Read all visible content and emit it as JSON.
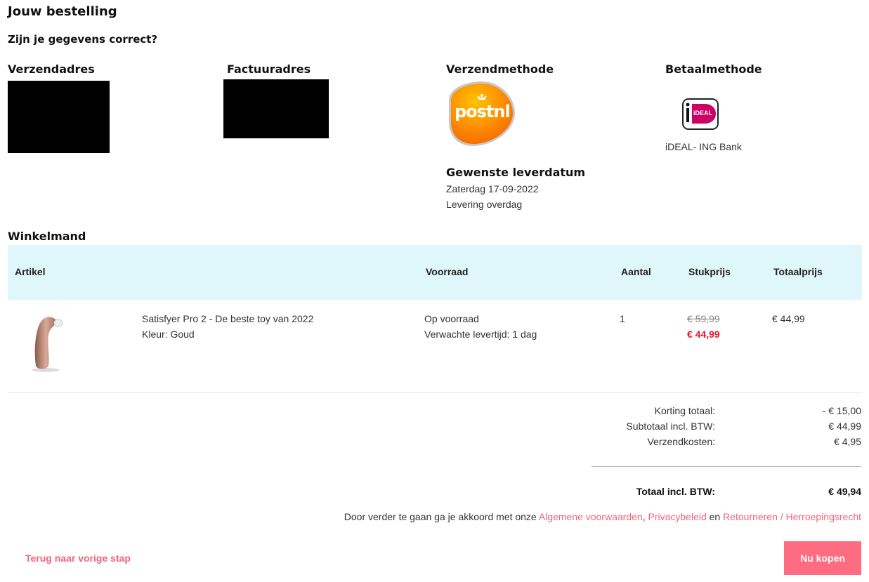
{
  "page": {
    "title": "Jouw bestelling",
    "subtitle": "Zijn je gegevens correct?"
  },
  "sections": {
    "shipping_address": "Verzendadres",
    "billing_address": "Factuuradres",
    "shipping_method": "Verzendmethode",
    "payment_method": "Betaalmethode"
  },
  "shipping": {
    "carrier_logo_text": "postnl",
    "desired_date_label": "Gewenste leverdatum",
    "desired_date": "Zaterdag 17-09-2022",
    "delivery_time": "Levering overdag"
  },
  "payment": {
    "logo_text": "iDEAL",
    "name": "iDEAL- ING Bank"
  },
  "cart": {
    "title": "Winkelmand",
    "columns": [
      "Artikel",
      "Voorraad",
      "Aantal",
      "Stukprijs",
      "Totaalprijs"
    ],
    "item": {
      "name": "Satisfyer Pro 2 - De beste toy van 2022",
      "variant": "Kleur: Goud",
      "stock": "Op voorraad",
      "delivery": "Verwachte levertijd: 1 dag",
      "qty": "1",
      "old_price": "€ 59,99",
      "price": "€ 44,99",
      "total": "€ 44,99"
    }
  },
  "summary": {
    "discount_label": "Korting totaal:",
    "discount_value": "- € 15,00",
    "subtotal_label": "Subtotaal incl. BTW:",
    "subtotal_value": "€ 44,99",
    "shipping_label": "Verzendkosten:",
    "shipping_value": "€ 4,95",
    "total_label": "Totaal incl. BTW:",
    "total_value": "€ 49,94"
  },
  "terms": {
    "prefix": "Door verder te gaan ga je akkoord met onze ",
    "link1": "Algemene voorwaarden",
    "comma": ", ",
    "link2": "Privacybeleid",
    "and": " en ",
    "link3": "Retourneren / Herroepingsrecht"
  },
  "actions": {
    "back": "Terug naar vorige stap",
    "buy": "Nu kopen"
  },
  "colors": {
    "accent": "#ff6b80",
    "link": "#f06477",
    "sale": "#e3172f",
    "table_header": "#dff7fb"
  }
}
